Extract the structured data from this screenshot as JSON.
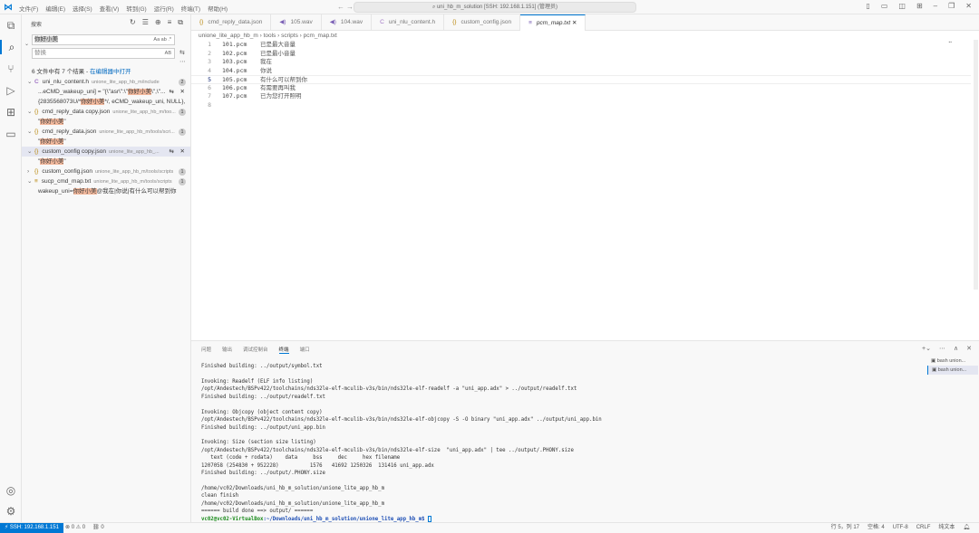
{
  "titlebar": {
    "menus": [
      "文件(F)",
      "编辑(E)",
      "选择(S)",
      "查看(V)",
      "转到(G)",
      "运行(R)",
      "终端(T)",
      "帮助(H)"
    ],
    "command_center": "uni_hb_m_solution [SSH: 192.168.1.151] (管理员)"
  },
  "sidebar": {
    "title": "搜索",
    "search_value": "你好小美",
    "search_opts": "Aa ab .*",
    "replace_placeholder": "替换",
    "replace_opt": "AB",
    "summary": "6 文件中有 7 个结果 - ",
    "open_in_editor": "在编辑器中打开",
    "results": [
      {
        "type": "file",
        "icon": "C",
        "name": "uni_nlu_content.h",
        "path": "unione_lite_app_hb_m/include",
        "count": "2"
      },
      {
        "type": "match",
        "pre": "...eCMD_wakeup_uni] = \"{\\\"asr\\\":\\\"",
        "hit": "你好小美",
        "post": "\\\",\\\"..."
      },
      {
        "type": "match",
        "pre": "{2835568073U/*",
        "hit": "你好小美",
        "post": "*/, eCMD_wakeup_uni, NULL},"
      },
      {
        "type": "file",
        "icon": "{}",
        "name": "cmd_reply_data copy.json",
        "path": "unione_lite_app_hb_m/too...",
        "count": "1"
      },
      {
        "type": "match",
        "pre": "\"",
        "hit": "你好小美",
        "post": "\""
      },
      {
        "type": "file",
        "icon": "{}",
        "name": "cmd_reply_data.json",
        "path": "unione_lite_app_hb_m/tools/scri...",
        "count": "1"
      },
      {
        "type": "match",
        "pre": "\"",
        "hit": "你好小美",
        "post": "\""
      },
      {
        "type": "file",
        "icon": "{}",
        "name": "custom_config copy.json",
        "path": "unione_lite_app_hb_...",
        "count": ""
      },
      {
        "type": "match",
        "pre": "\"",
        "hit": "你好小美",
        "post": "\""
      },
      {
        "type": "file",
        "icon": "{}",
        "name": "custom_config.json",
        "path": "unione_lite_app_hb_m/tools/scripts",
        "count": "1"
      },
      {
        "type": "file",
        "icon": "≡",
        "name": "sucp_cmd_map.txt",
        "path": "unione_lite_app_hb_m/tools/scripts",
        "count": "1"
      },
      {
        "type": "match",
        "pre": "wakeup_uni=",
        "hit": "你好小美",
        "post": "@我在|你说|有什么可以帮到你"
      }
    ]
  },
  "tabs": [
    "cmd_reply_data.json",
    "105.wav",
    "104.wav",
    "uni_nlu_content.h",
    "custom_config.json",
    "pcm_map.txt"
  ],
  "tab_icons": [
    "{}",
    "◀)",
    "◀)",
    "C",
    "{}",
    "≡"
  ],
  "breadcrumb": [
    "unione_lite_app_hb_m",
    "tools",
    "scripts",
    "pcm_map.txt"
  ],
  "editor_lines": [
    {
      "n": "1",
      "file": "101.pcm",
      "text": "已是最大音量"
    },
    {
      "n": "2",
      "file": "102.pcm",
      "text": "已是最小音量"
    },
    {
      "n": "3",
      "file": "103.pcm",
      "text": "我在"
    },
    {
      "n": "4",
      "file": "104.pcm",
      "text": "你说"
    },
    {
      "n": "5",
      "file": "105.pcm",
      "text": "有什么可以帮到你"
    },
    {
      "n": "6",
      "file": "106.pcm",
      "text": "有需要再叫我"
    },
    {
      "n": "7",
      "file": "107.pcm",
      "text": "已为您打开照明"
    },
    {
      "n": "8",
      "file": "",
      "text": ""
    }
  ],
  "panel": {
    "tabs": [
      "问题",
      "输出",
      "调试控制台",
      "终端",
      "端口"
    ],
    "terminals": [
      "bash union...",
      "bash union..."
    ],
    "terminal_lines": [
      "Finished building: ../output/symbol.txt",
      "",
      "Invoking: Readelf (ELF info listing)",
      "/opt/Andestech/BSPv422/toolchains/nds32le-elf-mculib-v3s/bin/nds32le-elf-readelf -a \"uni_app.adx\" > ../output/readelf.txt",
      "Finished building: ../output/readelf.txt",
      "",
      "Invoking: Objcopy (object content copy)",
      "/opt/Andestech/BSPv422/toolchains/nds32le-elf-mculib-v3s/bin/nds32le-elf-objcopy -S -O binary \"uni_app.adx\" ../output/uni_app.bin",
      "Finished building: ../output/uni_app.bin",
      "",
      "Invoking: Size (section size listing)",
      "/opt/Andestech/BSPv422/toolchains/nds32le-elf-mculib-v3s/bin/nds32le-elf-size  \"uni_app.adx\" | tee ../output/.PHONY.size",
      "   text (code + rodata)    data     bss     dec     hex filename",
      "1207058 (254830 + 952228)          1576   41692 1250326  131416 uni_app.adx",
      "Finished building: ../output/.PHONY.size",
      "",
      "/home/vc02/Downloads/uni_hb_m_solution/unione_lite_app_hb_m",
      "clean finish",
      "/home/vc02/Downloads/uni_hb_m_solution/unione_lite_app_hb_m",
      "====== build done ==> output/ ======"
    ],
    "prompt_user": "vc02@vc02-VirtualBox",
    "prompt_path": ":~/Downloads/uni_hb_m_solution/unione_lite_app_hb_m$"
  },
  "statusbar": {
    "remote": "SSH: 192.168.1.151",
    "problems": "⊗ 0 ⚠ 0",
    "ports": "⛓ 0",
    "position": "行 5，列 17",
    "indent": "空格: 4",
    "encoding": "UTF-8",
    "eol": "CRLF",
    "language": "纯文本"
  },
  "colors": {
    "accent": "#0078d4",
    "highlight": "#f3b99d"
  }
}
